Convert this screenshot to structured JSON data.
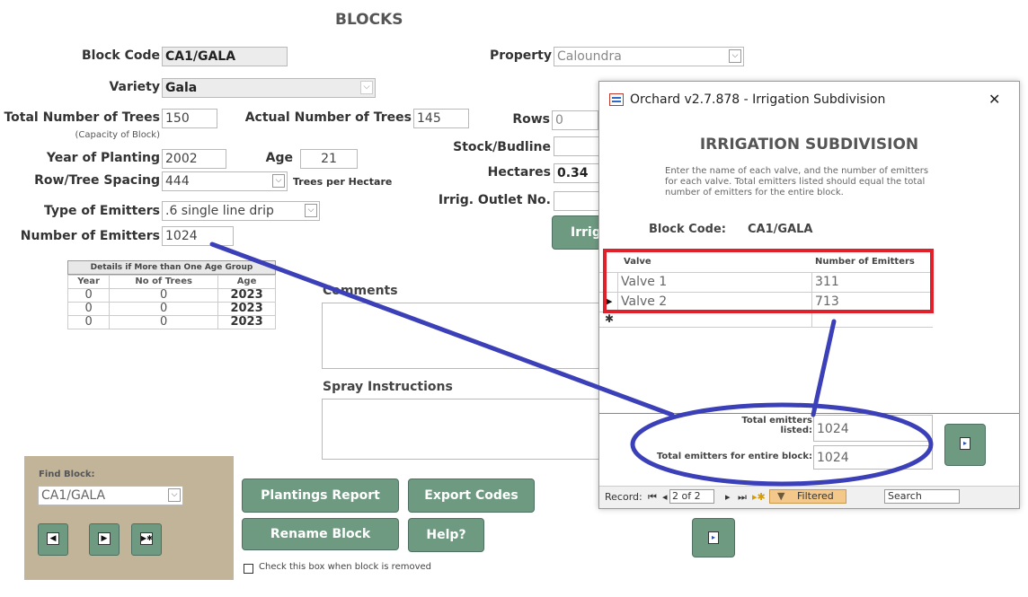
{
  "form": {
    "title": "BLOCKS",
    "block_code_label": "Block Code",
    "block_code": "CA1/GALA",
    "property_label": "Property",
    "property": "Caloundra",
    "variety_label": "Variety",
    "variety": "Gala",
    "total_trees_label": "Total Number of Trees",
    "total_trees_note": "(Capacity of Block)",
    "total_trees": "150",
    "actual_trees_label": "Actual Number of Trees",
    "actual_trees": "145",
    "rows_label": "Rows",
    "rows": "0",
    "year_planting_label": "Year of Planting",
    "year_planting": "2002",
    "age_label": "Age",
    "age": "21",
    "stock_label": "Stock/Budline",
    "stock": "",
    "row_spacing_label": "Row/Tree Spacing",
    "row_spacing": "444",
    "trees_per_hectare_label": "Trees per Hectare",
    "hectares_label": "Hectares",
    "hectares": "0.34",
    "emitters_type_label": "Type of Emitters",
    "emitters_type": ".6 single line drip",
    "irrig_outlet_label": "Irrig. Outlet No.",
    "irrig_outlet": "",
    "irrig_button_partial": "Irrig",
    "num_emitters_label": "Number of Emitters",
    "num_emitters": "1024",
    "comments_label": "Comments",
    "spray_label": "Spray Instructions",
    "remove_checkbox_label": "Check this box when block is removed"
  },
  "age_groups": {
    "title": "Details if More than One Age Group",
    "headers": [
      "Year",
      "No of Trees",
      "Age"
    ],
    "rows": [
      [
        "0",
        "0",
        "2023"
      ],
      [
        "0",
        "0",
        "2023"
      ],
      [
        "0",
        "0",
        "2023"
      ]
    ]
  },
  "find_block": {
    "label": "Find Block:",
    "value": "CA1/GALA"
  },
  "buttons": {
    "plantings_report": "Plantings Report",
    "export_codes": "Export Codes",
    "rename_block": "Rename Block",
    "help": "Help?"
  },
  "modal": {
    "window_title": "Orchard v2.7.878 - Irrigation Subdivision",
    "close": "✕",
    "heading": "IRRIGATION SUBDIVISION",
    "instructions": "Enter the name of each valve, and the number of emitters for each valve.  Total emitters listed should equal the total number of emitters for the entire block.",
    "block_code_label": "Block Code:",
    "block_code": "CA1/GALA",
    "grid_headers": [
      "Valve",
      "Number of Emitters"
    ],
    "grid_rows": [
      {
        "valve": "Valve 1",
        "emitters": "311"
      },
      {
        "valve": "Valve 2",
        "emitters": "713"
      }
    ],
    "total_listed_label": "Total emitters listed:",
    "total_listed": "1024",
    "total_block_label": "Total emitters for entire block:",
    "total_block": "1024",
    "record_label": "Record:",
    "record_value": "2 of 2",
    "filtered_label": "Filtered",
    "search_label": "Search"
  },
  "colors": {
    "accent_green": "#6f9a82",
    "panel_tan": "#c2b498",
    "highlight_red": "#e0202a",
    "annotation_blue": "#3b40b8",
    "heading_grey": "#555555"
  }
}
